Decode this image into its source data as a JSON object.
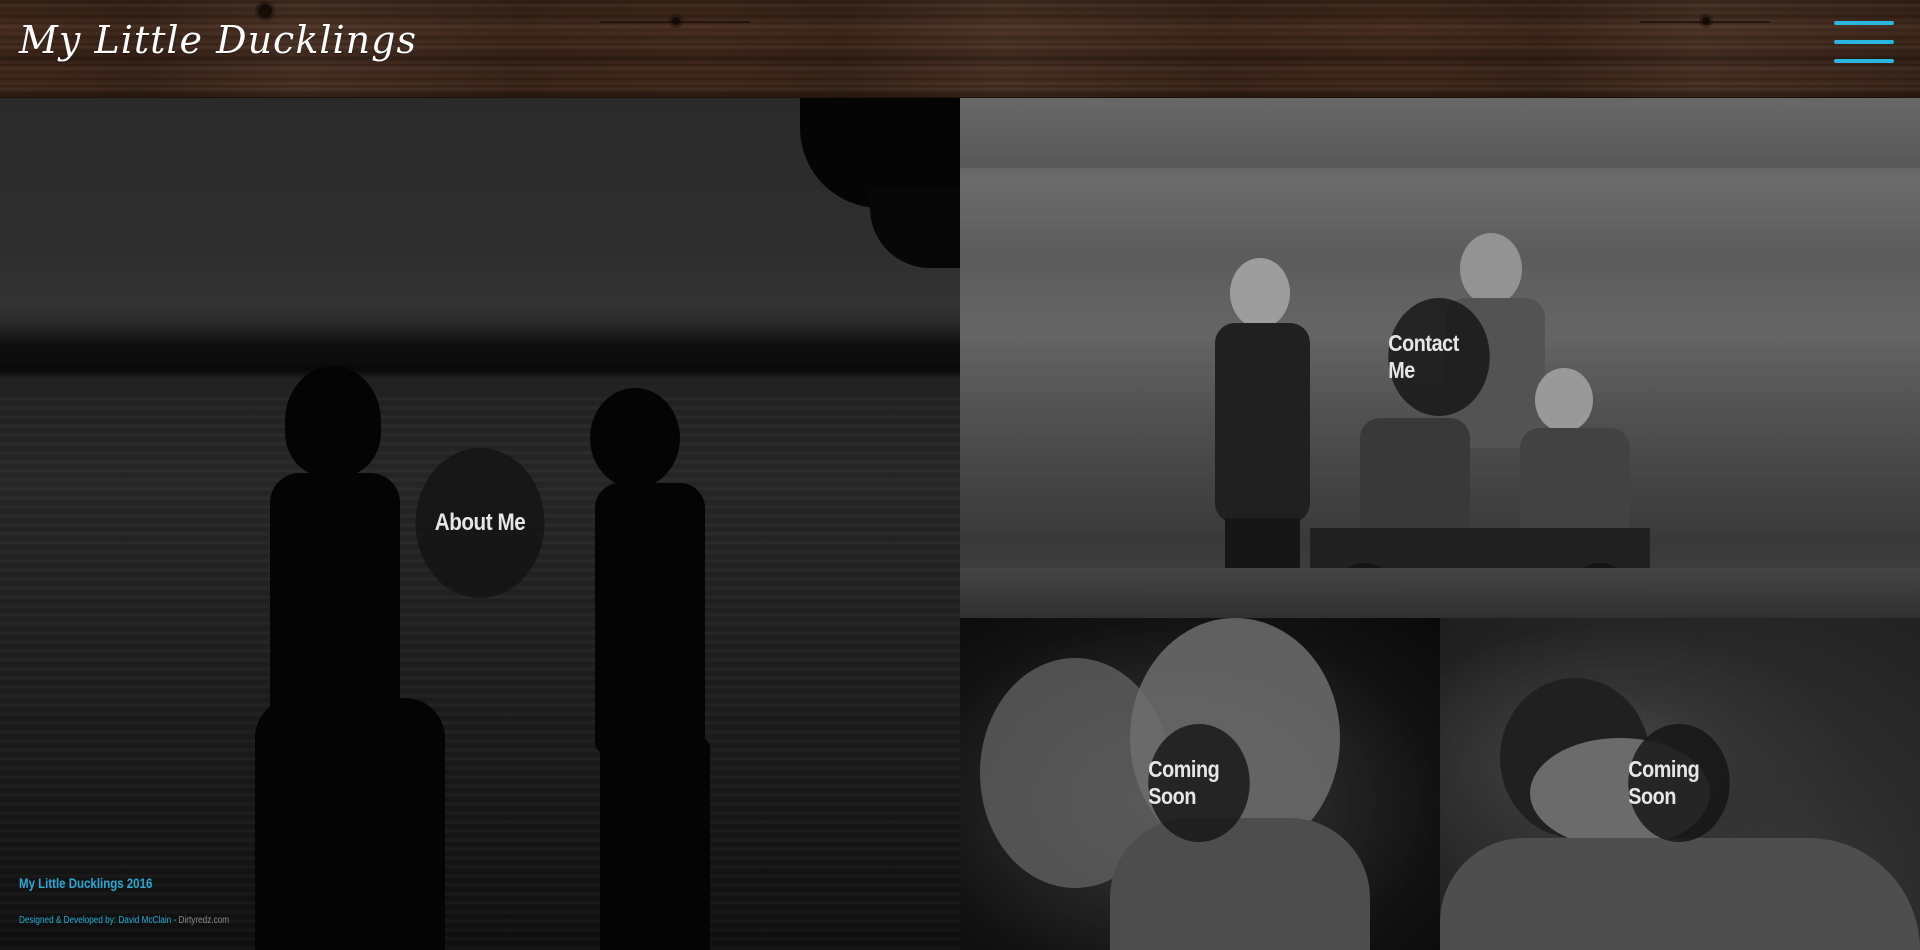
{
  "header": {
    "site_title": "My Little Ducklings",
    "menu_icon": "hamburger-menu-icon",
    "menu_color": "#29b6e1"
  },
  "tiles": [
    {
      "label": "About Me",
      "photo": "two girls silhouetted at lake"
    },
    {
      "label": "Contact Me",
      "photo": "children with wagon by lake"
    },
    {
      "label": "Coming Soon",
      "photo": "two smiling girls"
    },
    {
      "label": "Coming Soon",
      "photo": "sleeping newborn"
    }
  ],
  "footer": {
    "title": "My Little Ducklings 2016",
    "credit_prefix": "Designed & Developed by: David McClain",
    "credit_separator": " - ",
    "credit_domain": "Dirtyredz.com",
    "accent_color": "#29a9d3"
  }
}
